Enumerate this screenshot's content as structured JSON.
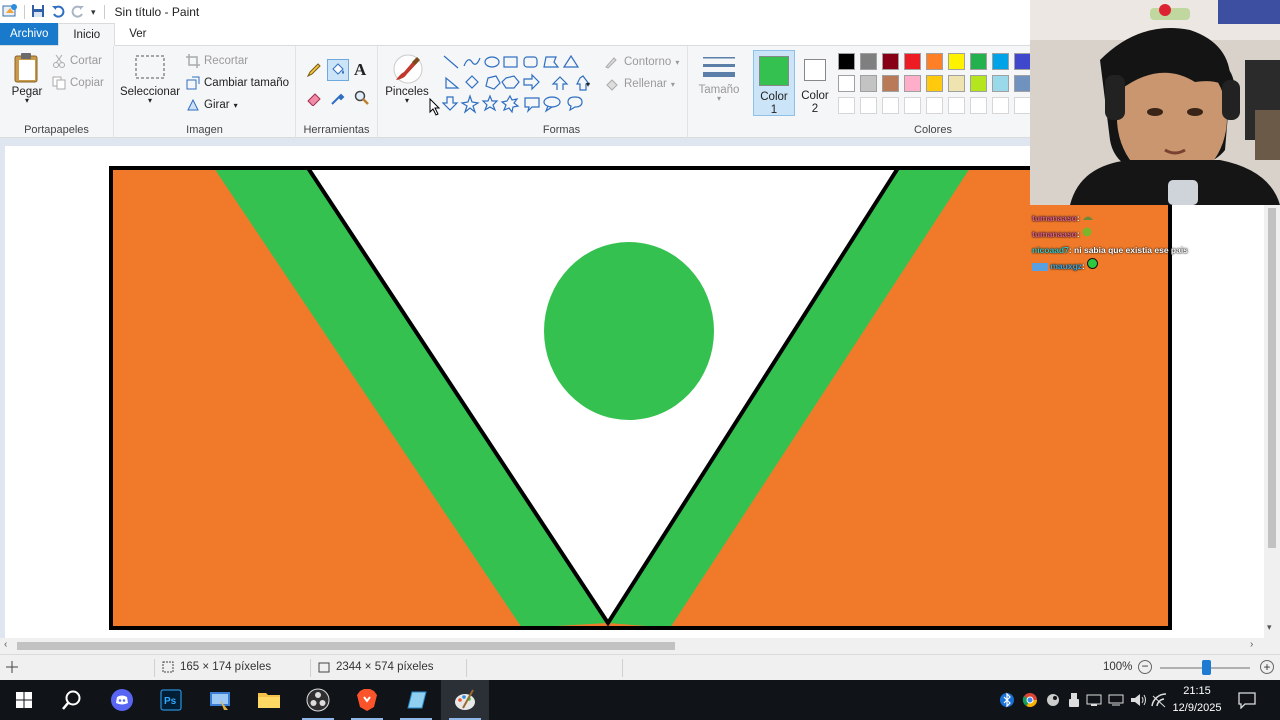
{
  "window": {
    "title": "Sin título - Paint"
  },
  "menu_tabs": [
    "Archivo",
    "Inicio",
    "Ver"
  ],
  "ribbon": {
    "portapapeles": {
      "label": "Portapapeles",
      "paste": "Pegar",
      "cut": "Cortar",
      "copy": "Copiar"
    },
    "imagen": {
      "label": "Imagen",
      "select": "Seleccionar",
      "crop": "Recortar",
      "resize": "Cambiar tamaño",
      "rotate": "Girar"
    },
    "herramientas": {
      "label": "Herramientas"
    },
    "pinceles": {
      "label": "Pinceles"
    },
    "formas": {
      "label": "Formas",
      "outline": "Contorno",
      "fill": "Rellenar"
    },
    "tamano": {
      "label": "Tamaño"
    },
    "color1": {
      "label": "Color",
      "num": "1",
      "value": "#34c14f"
    },
    "color2": {
      "label": "Color",
      "num": "2",
      "value": "#ffffff"
    },
    "colores": {
      "label": "Colores",
      "row1": [
        "#000000",
        "#7f7f7f",
        "#880015",
        "#ed1c24",
        "#ff7f27",
        "#fff200",
        "#22b14c",
        "#00a2e8",
        "#3f48cc"
      ],
      "row2": [
        "#ffffff",
        "#c3c3c3",
        "#b97a57",
        "#ffaec9",
        "#ffc90e",
        "#efe4b0",
        "#b5e61d",
        "#99d9ea",
        "#7092be"
      ]
    }
  },
  "drawing": {
    "orange": "#f07a2a",
    "green": "#34c14f",
    "white": "#ffffff",
    "outline": "#000000"
  },
  "status": {
    "selection_size": "165 × 174 píxeles",
    "image_size": "2344 × 574 píxeles",
    "zoom": "100%"
  },
  "taskbar": {
    "time": "21:15",
    "date": "12/9/2025"
  },
  "chat": [
    {
      "user": "tumanaaso",
      "text": ":"
    },
    {
      "user": "tumanaaso",
      "text": ":"
    },
    {
      "user": "nicoaad7",
      "text": ": ni sabia que existia ese pais"
    },
    {
      "user": "mauxgz",
      "text": ":"
    }
  ]
}
